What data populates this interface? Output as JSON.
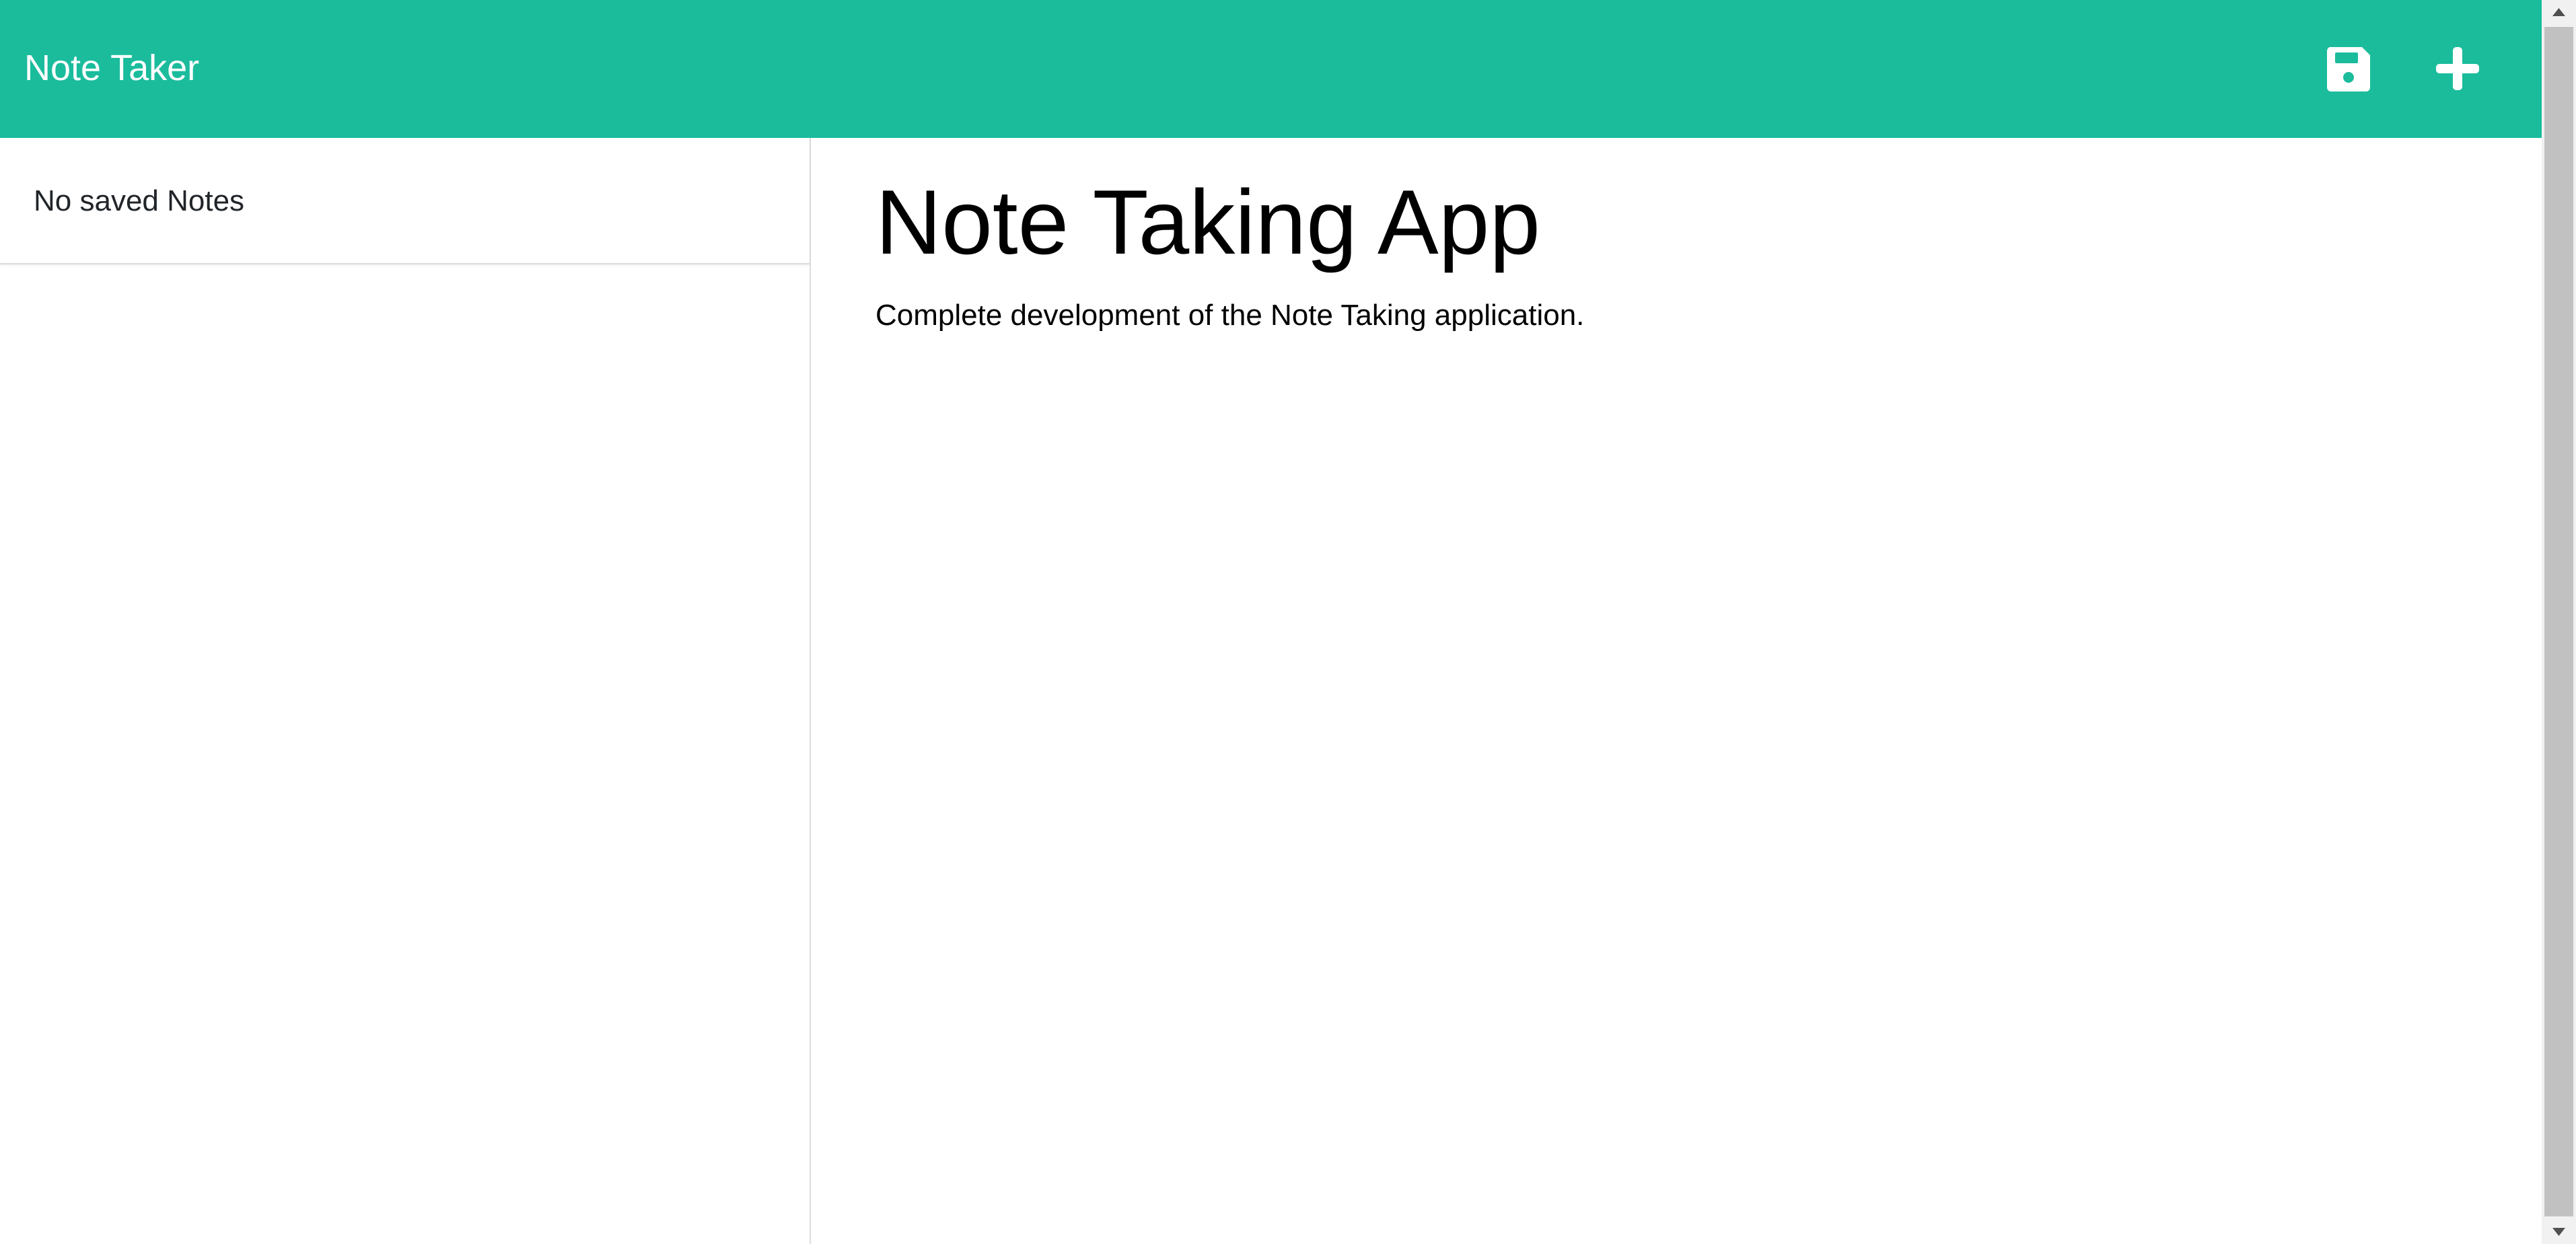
{
  "navbar": {
    "brand": "Note Taker",
    "background_color": "#1abc9c",
    "save_icon": "save-icon",
    "new_note_icon": "plus-icon"
  },
  "sidebar": {
    "empty_message": "No saved Notes"
  },
  "main": {
    "note_title": "Note Taking App",
    "note_text": "Complete development of the Note Taking application."
  }
}
